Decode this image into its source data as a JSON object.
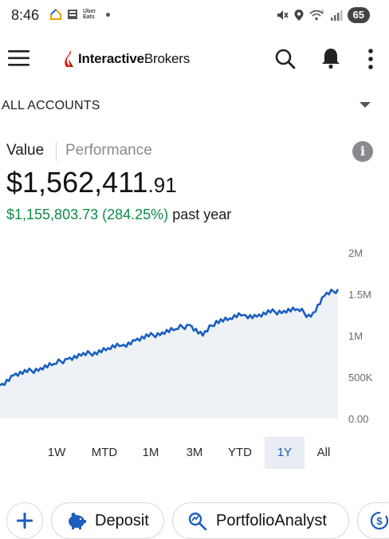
{
  "status_bar": {
    "time": "8:46",
    "uber_eats_line1": "Uber",
    "uber_eats_line2": "Eats",
    "battery": "65",
    "wifi_badge": "5"
  },
  "header": {
    "brand_bold": "Interactive",
    "brand_regular": "Brokers",
    "brand_color": "#d81e05"
  },
  "accounts": {
    "label": "ALL ACCOUNTS"
  },
  "tabs": {
    "value": "Value",
    "performance": "Performance"
  },
  "summary": {
    "value_whole": "$1,562,411",
    "value_cents": ".91",
    "change": "$1,155,803.73 (284.25%)",
    "change_suffix": "past year",
    "gain_color": "#0f8a48"
  },
  "chart_data": {
    "type": "line",
    "title": "",
    "xlabel": "",
    "ylabel": "",
    "y_tick_labels": [
      "2M",
      "1.5M",
      "1M",
      "500K",
      "0.00"
    ],
    "ylim": [
      0,
      2000000
    ],
    "grid": false,
    "line_color": "#1a5fbf",
    "fill_color": "#eef1f6",
    "x": [
      0,
      4,
      8,
      12,
      16,
      20,
      24,
      28,
      32,
      36,
      40,
      44,
      48,
      52,
      56,
      60,
      64,
      68,
      72,
      76,
      80,
      84,
      88,
      92,
      96,
      100
    ],
    "values": [
      400000,
      520000,
      560000,
      610000,
      660000,
      720000,
      760000,
      800000,
      850000,
      880000,
      940000,
      990000,
      1040000,
      1080000,
      1130000,
      1000000,
      1180000,
      1210000,
      1250000,
      1230000,
      1280000,
      1300000,
      1320000,
      1230000,
      1480000,
      1560000
    ]
  },
  "range": {
    "options": [
      "1W",
      "MTD",
      "1M",
      "3M",
      "YTD",
      "1Y",
      "All"
    ],
    "selected": "1Y"
  },
  "actions": {
    "deposit": "Deposit",
    "portfolio_analyst": "PortfolioAnalyst"
  }
}
